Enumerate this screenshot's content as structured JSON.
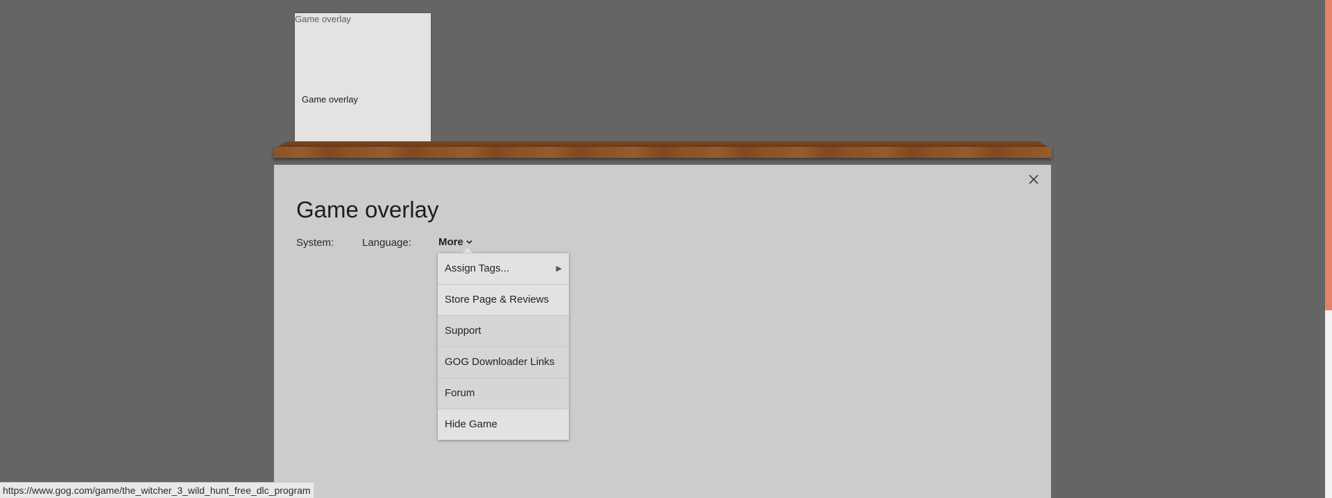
{
  "library": {
    "tile": {
      "image_alt": "Game overlay",
      "title": "Game overlay"
    }
  },
  "details": {
    "title": "Game overlay",
    "system_label": "System:",
    "language_label": "Language:",
    "more_label": "More",
    "close_icon": "close-icon"
  },
  "menu": {
    "items": [
      {
        "label": "Assign Tags...",
        "has_submenu": true,
        "submenu_arrow": "▶"
      },
      {
        "label": "Store Page & Reviews"
      },
      {
        "label": "Support"
      },
      {
        "label": "GOG Downloader Links"
      },
      {
        "label": "Forum"
      },
      {
        "label": "Hide Game"
      }
    ]
  },
  "status_bar": {
    "url": "https://www.gog.com/game/the_witcher_3_wild_hunt_free_dlc_program"
  },
  "colors": {
    "background": "#656565",
    "panel": "#cccccc",
    "shelf_wood": "#8a5326",
    "scrollbar_accent": "#e7826a"
  }
}
